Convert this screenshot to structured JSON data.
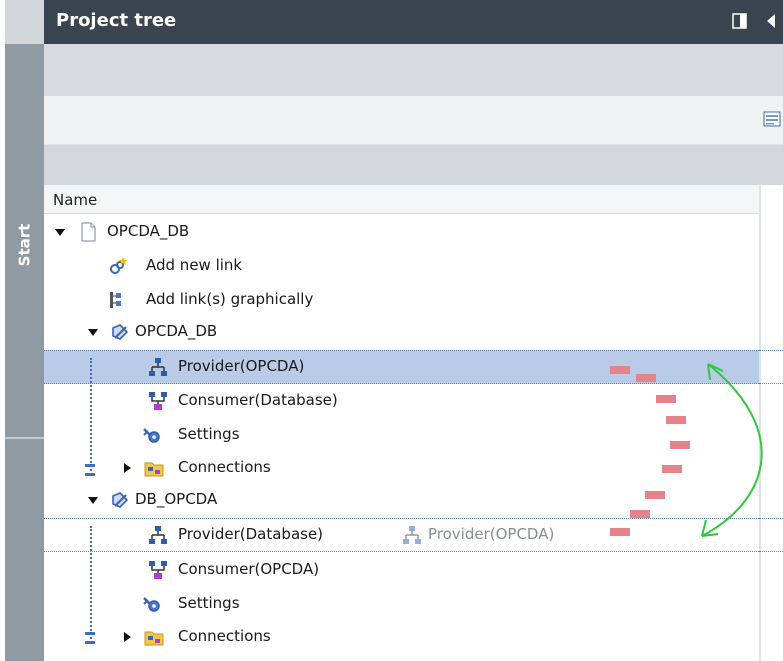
{
  "panel": {
    "title": "Project tree",
    "side_label": "Start",
    "column_header": "Name"
  },
  "tree": {
    "root_label": "OPCDA_DB",
    "add_new_link": "Add new link",
    "add_links_graphically": "Add link(s) graphically",
    "link1": {
      "label": "OPCDA_DB",
      "provider": "Provider(OPCDA)",
      "consumer": "Consumer(Database)",
      "settings": "Settings",
      "connections": "Connections"
    },
    "link2": {
      "label": "DB_OPCDA",
      "provider": "Provider(Database)",
      "drag_ghost": "Provider(OPCDA)",
      "consumer": "Consumer(OPCDA)",
      "settings": "Settings",
      "connections": "Connections"
    }
  },
  "colors": {
    "header_bg": "#39444e",
    "rail_bg": "#8f9aa3",
    "selection_bg": "#b9cbe6",
    "arrow": "#2ec73f",
    "dash_marker": "#e5838a"
  },
  "icons": [
    "collapse-panel-icon",
    "pin-icon",
    "list-view-icon",
    "document-icon",
    "add-link-icon",
    "graphical-link-icon",
    "link-icon",
    "provider-icon",
    "consumer-icon",
    "settings-icon",
    "connections-folder-icon"
  ]
}
